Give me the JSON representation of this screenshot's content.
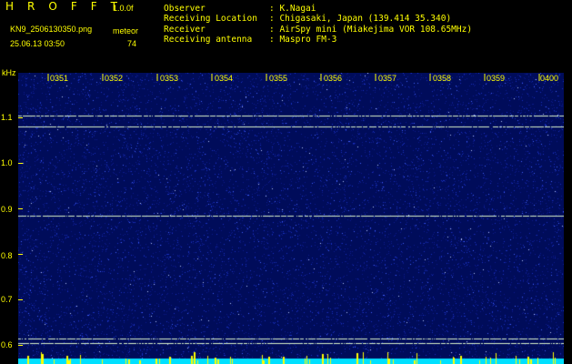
{
  "header": {
    "app_title": "H R O F F T",
    "version": "1.0.0f",
    "filename": "KN9_2506130350.png",
    "meteor_label": "meteor",
    "datetime": "25.06.13 03:50",
    "meteor_count": "74"
  },
  "metadata": [
    {
      "label": "Observer",
      "value": ": K.Nagai"
    },
    {
      "label": "Receiving Location",
      "value": ": Chigasaki, Japan (139.414 35.340)"
    },
    {
      "label": "Receiver",
      "value": ": AirSpy mini (Miakejima VOR 108.65MHz)"
    },
    {
      "label": "Receiving antenna",
      "value": ": Maspro FM-3"
    }
  ],
  "spectrogram": {
    "y_unit": "kHz",
    "y_ticks": [
      "1.1",
      "1.0",
      "0.9",
      "0.8",
      "0.7",
      "0.6"
    ],
    "x_ticks": [
      "0351",
      "0352",
      "0353",
      "0354",
      "0355",
      "0356",
      "0357",
      "0358",
      "0359",
      "0400"
    ],
    "colors": {
      "background": "#000000",
      "noise_base": "#000c5a",
      "noise_bright": "#4060ff",
      "signal_line": "#d8f0c8",
      "bottom_band": "#00e0ff",
      "axis_text": "#ffff00",
      "meteor_marks": "#ffff00"
    }
  },
  "chart_data": {
    "type": "heatmap",
    "title": "",
    "xlabel": "",
    "ylabel": "kHz",
    "x_ticks": [
      "0351",
      "0352",
      "0353",
      "0354",
      "0355",
      "0356",
      "0357",
      "0358",
      "0359",
      "0400"
    ],
    "y_ticks": [
      1.1,
      1.0,
      0.9,
      0.8,
      0.7,
      0.6
    ],
    "ylim": [
      0.57,
      1.2
    ],
    "horizontal_signal_lines_khz": [
      1.105,
      1.08,
      0.885,
      0.615,
      0.605
    ]
  }
}
